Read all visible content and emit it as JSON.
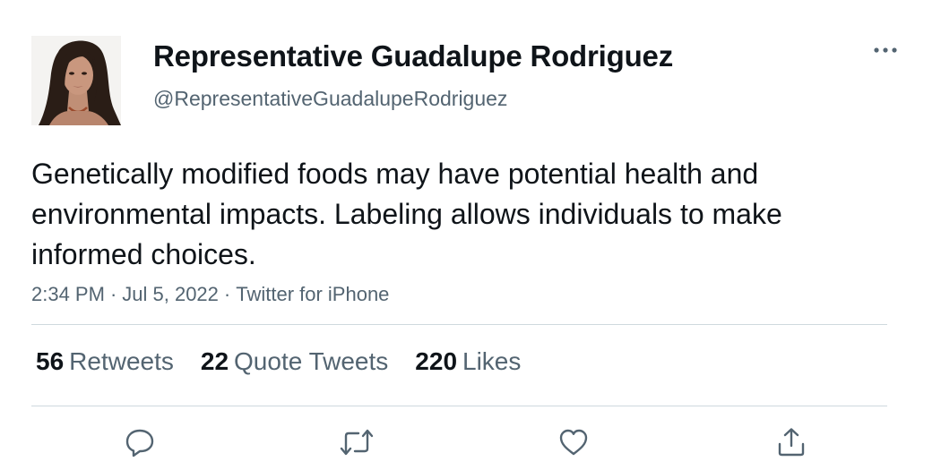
{
  "author": {
    "display_name": "Representative Guadalupe Rodriguez",
    "handle": "@RepresentativeGuadalupeRodriguez",
    "avatar": "portrait-photo"
  },
  "tweet": {
    "text": "Genetically modified foods may have potential health and environmental impacts. Labeling allows individuals to make informed choices.",
    "time": "2:34 PM",
    "date": "Jul 5, 2022",
    "source": "Twitter for iPhone",
    "separator": "·"
  },
  "stats": {
    "retweets_count": "56",
    "retweets_label": "Retweets",
    "quotes_count": "22",
    "quotes_label": "Quote Tweets",
    "likes_count": "220",
    "likes_label": "Likes"
  },
  "actions": {
    "icons": [
      "reply-icon",
      "retweet-icon",
      "like-icon",
      "share-icon"
    ],
    "more_icon": "more-dots-icon"
  },
  "colors": {
    "primary_text": "#0f1419",
    "secondary_text": "#536471",
    "divider": "#cfd9de"
  }
}
